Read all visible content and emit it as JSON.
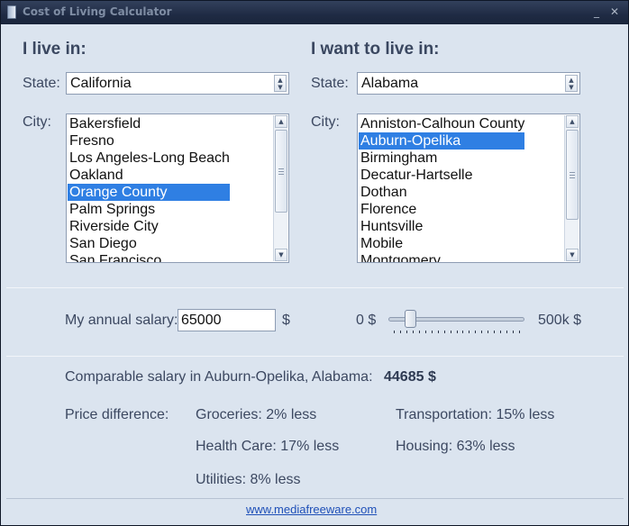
{
  "window": {
    "title": "Cost of Living Calculator"
  },
  "left": {
    "heading": "I live in:",
    "state_label": "State:",
    "state_value": "California",
    "city_label": "City:",
    "cities": [
      "Bakersfield",
      "Fresno",
      "Los Angeles-Long Beach",
      "Oakland",
      "Orange County",
      "Palm Springs",
      "Riverside City",
      "San Diego",
      "San Francisco"
    ],
    "selected_city": "Orange County"
  },
  "right": {
    "heading": "I want to live in:",
    "state_label": "State:",
    "state_value": "Alabama",
    "city_label": "City:",
    "cities": [
      "Anniston-Calhoun County",
      "Auburn-Opelika",
      "Birmingham",
      "Decatur-Hartselle",
      "Dothan",
      "Florence",
      "Huntsville",
      "Mobile",
      "Montgomery"
    ],
    "selected_city": "Auburn-Opelika"
  },
  "salary": {
    "label": "My annual salary:",
    "value": "65000",
    "currency": "$",
    "slider_min_label": "0 $",
    "slider_max_label": "500k $",
    "slider_level": 0.13
  },
  "result": {
    "comparable_label": "Comparable salary in Auburn-Opelika, Alabama:",
    "comparable_value": "44685 $",
    "price_diff_label": "Price difference:",
    "groceries": "Groceries: 2% less",
    "transportation": "Transportation: 15% less",
    "health_care": "Health Care: 17% less",
    "housing": "Housing: 63% less",
    "utilities": "Utilities: 8% less"
  },
  "footer": {
    "link": "www.mediafreeware.com"
  },
  "colors": {
    "selection": "#2f7fe3",
    "titlebar": "#1f2b44",
    "background": "#dbe4ef",
    "link": "#1f50b8"
  }
}
